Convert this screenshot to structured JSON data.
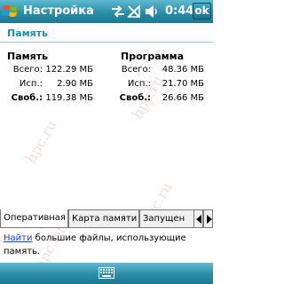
{
  "title_bar": {
    "title": "Настройка",
    "time": "0:44",
    "ok_label": "ok",
    "icons": [
      "windows-start-icon",
      "connectivity-icon",
      "no-signal-icon",
      "speaker-icon"
    ]
  },
  "page_header": "Память",
  "memory": {
    "title": "Память",
    "total_label": "Всего:",
    "total_value": "122.29 МБ",
    "used_label": "Исп.:",
    "used_value": "2.90 МБ",
    "free_label": "Своб.:",
    "free_value": "119.38 МБ"
  },
  "program": {
    "title": "Программа",
    "total_label": "Всего:",
    "total_value": "48.36 МБ",
    "used_label": "Исп.:",
    "used_value": "21.70 МБ",
    "free_label": "Своб.:",
    "free_value": "26.66 МБ"
  },
  "tabs": [
    "Оперативная",
    "Карта памяти",
    "Запущен"
  ],
  "hint": {
    "link": "Найти",
    "text": " большие файлы, использующие память."
  },
  "watermark": "hpc.ru",
  "colors": {
    "header_accent": "#1e8fb1",
    "bar": "#2a8ea8",
    "link": "#1a3fcf"
  }
}
